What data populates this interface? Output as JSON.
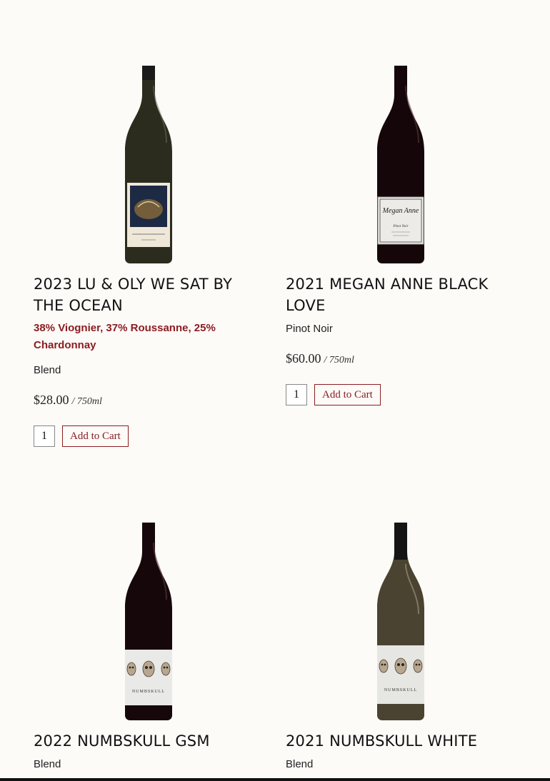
{
  "products": [
    {
      "title": "2023 LU & OLY WE SAT BY THE OCEAN",
      "blend_desc": "38% Viognier, 37% Roussanne, 25% Chardonnay",
      "varietal": "Blend",
      "price": "$28.00",
      "volume": "/ 750ml",
      "qty": "1",
      "add_to_cart": "Add to Cart",
      "bottle_color": "#2b2c1e",
      "label_style": "ocean-art"
    },
    {
      "title": "2021 MEGAN ANNE BLACK LOVE",
      "varietal": "Pinot Noir",
      "price": "$60.00",
      "volume": "/ 750ml",
      "qty": "1",
      "add_to_cart": "Add to Cart",
      "bottle_color": "#150709",
      "label_style": "white-script",
      "label_text": "Megan Anne",
      "label_sub": "Pinot Noir"
    },
    {
      "title": "2022 NUMBSKULL GSM",
      "varietal": "Blend",
      "bottle_color": "#16080a",
      "label_style": "skulls",
      "label_text": "NUMBSKULL"
    },
    {
      "title": "2021 NUMBSKULL WHITE",
      "varietal": "Blend",
      "bottle_color": "#4a4331",
      "label_style": "skulls",
      "label_text": "NUMBSKULL"
    }
  ],
  "colors": {
    "accent": "#8a1d22",
    "background": "#fdfbf8"
  }
}
